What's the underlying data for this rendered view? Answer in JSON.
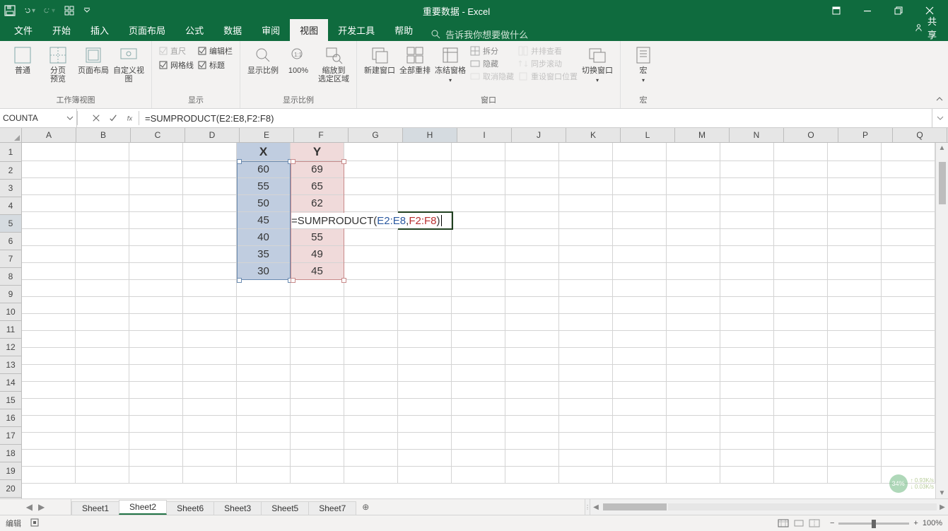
{
  "title": "重要数据 - Excel",
  "quick_access": [
    "save",
    "undo",
    "redo",
    "touch-mode",
    "customize"
  ],
  "window_controls": {
    "ribbon_options": "▾",
    "minimize": "–",
    "restore": "❐",
    "close": "✕"
  },
  "tabs": {
    "items": [
      "文件",
      "开始",
      "插入",
      "页面布局",
      "公式",
      "数据",
      "审阅",
      "视图",
      "开发工具",
      "帮助"
    ],
    "active_index": 7,
    "tell_me_placeholder": "告诉我你想要做什么",
    "share": "共享"
  },
  "ribbon": {
    "group1": {
      "label": "工作簿视图",
      "normal": "普通",
      "page_break": "分页\n预览",
      "page_layout": "页面布局",
      "custom_view": "自定义视图"
    },
    "group2": {
      "label": "显示",
      "ruler": "直尺",
      "formula_bar": "编辑栏",
      "gridlines": "网格线",
      "headings": "标题"
    },
    "group3": {
      "label": "显示比例",
      "zoom": "显示比例",
      "zoom100": "100%",
      "zoom_sel": "缩放到\n选定区域"
    },
    "group4": {
      "label": "窗口",
      "new_window": "新建窗口",
      "arrange": "全部重排",
      "freeze": "冻结窗格",
      "split": "拆分",
      "hide": "隐藏",
      "unhide": "取消隐藏",
      "side_by_side": "并排查看",
      "sync_scroll": "同步滚动",
      "reset_pos": "重设窗口位置",
      "switch": "切换窗口"
    },
    "group5": {
      "label": "宏",
      "macros": "宏"
    }
  },
  "name_box": "COUNTA",
  "formula_bar": {
    "text": "=SUMPRODUCT(E2:E8,F2:F8)"
  },
  "columns": [
    "A",
    "B",
    "C",
    "D",
    "E",
    "F",
    "G",
    "H",
    "I",
    "J",
    "K",
    "L",
    "M",
    "N",
    "O",
    "P",
    "Q"
  ],
  "rows": [
    "1",
    "2",
    "3",
    "4",
    "5",
    "6",
    "7",
    "8",
    "9",
    "10",
    "11",
    "12",
    "13",
    "14",
    "15",
    "16",
    "17",
    "18",
    "19",
    "20"
  ],
  "cells": {
    "header_X": "X",
    "header_Y": "Y",
    "E": [
      60,
      55,
      50,
      45,
      40,
      35,
      30
    ],
    "F": [
      69,
      65,
      62,
      "",
      55,
      49,
      45
    ]
  },
  "in_cell_formula": {
    "prefix": "=SUMPRODUCT(",
    "arg1": "E2:E8",
    "sep": ",",
    "arg2": "F2:F8",
    "suffix": ")"
  },
  "sheets": {
    "items": [
      "Sheet1",
      "Sheet2",
      "Sheet6",
      "Sheet3",
      "Sheet5",
      "Sheet7"
    ],
    "active_index": 1
  },
  "status": {
    "mode": "编辑",
    "macro_icon": "■",
    "zoom_label": "100%"
  },
  "network": {
    "pct": "34%",
    "up": "0.93K/s",
    "down": "0.03K/s"
  }
}
